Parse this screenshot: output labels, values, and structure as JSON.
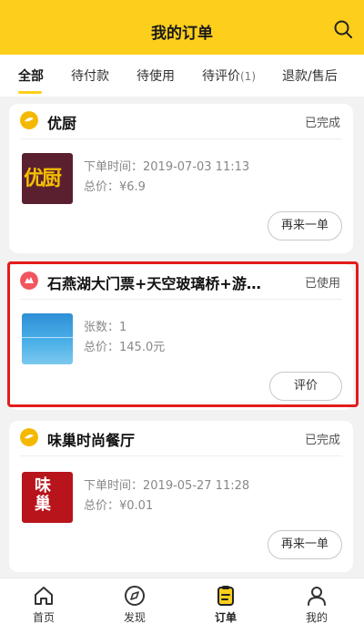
{
  "header": {
    "title": "我的订单"
  },
  "tabs": [
    {
      "label": "全部",
      "active": true
    },
    {
      "label": "待付款"
    },
    {
      "label": "待使用"
    },
    {
      "label": "待评价",
      "count": "(1)"
    },
    {
      "label": "退款/售后"
    }
  ],
  "orders": [
    {
      "shop": "优厨",
      "status": "已完成",
      "line1": "下单时间：2019-07-03 11:13",
      "line2": "总价：¥6.9",
      "button": "再来一单",
      "thumb_text": "优厨"
    },
    {
      "shop": "石燕湖大门票+天空玻璃桥+游…",
      "status": "已使用",
      "line1": "张数：1",
      "line2": "总价：145.0元",
      "button": "评价"
    },
    {
      "shop": "味巢时尚餐厅",
      "status": "已完成",
      "line1": "下单时间：2019-05-27 11:28",
      "line2": "总价：¥0.01",
      "button": "再来一单",
      "thumb_text": "味巢"
    }
  ],
  "nav": [
    {
      "label": "首页",
      "icon": "home-icon"
    },
    {
      "label": "发现",
      "icon": "compass-icon"
    },
    {
      "label": "订单",
      "icon": "order-icon",
      "active": true
    },
    {
      "label": "我的",
      "icon": "profile-icon"
    }
  ],
  "colors": {
    "accent": "#fdcf1c",
    "highlight": "#e31c1c"
  }
}
